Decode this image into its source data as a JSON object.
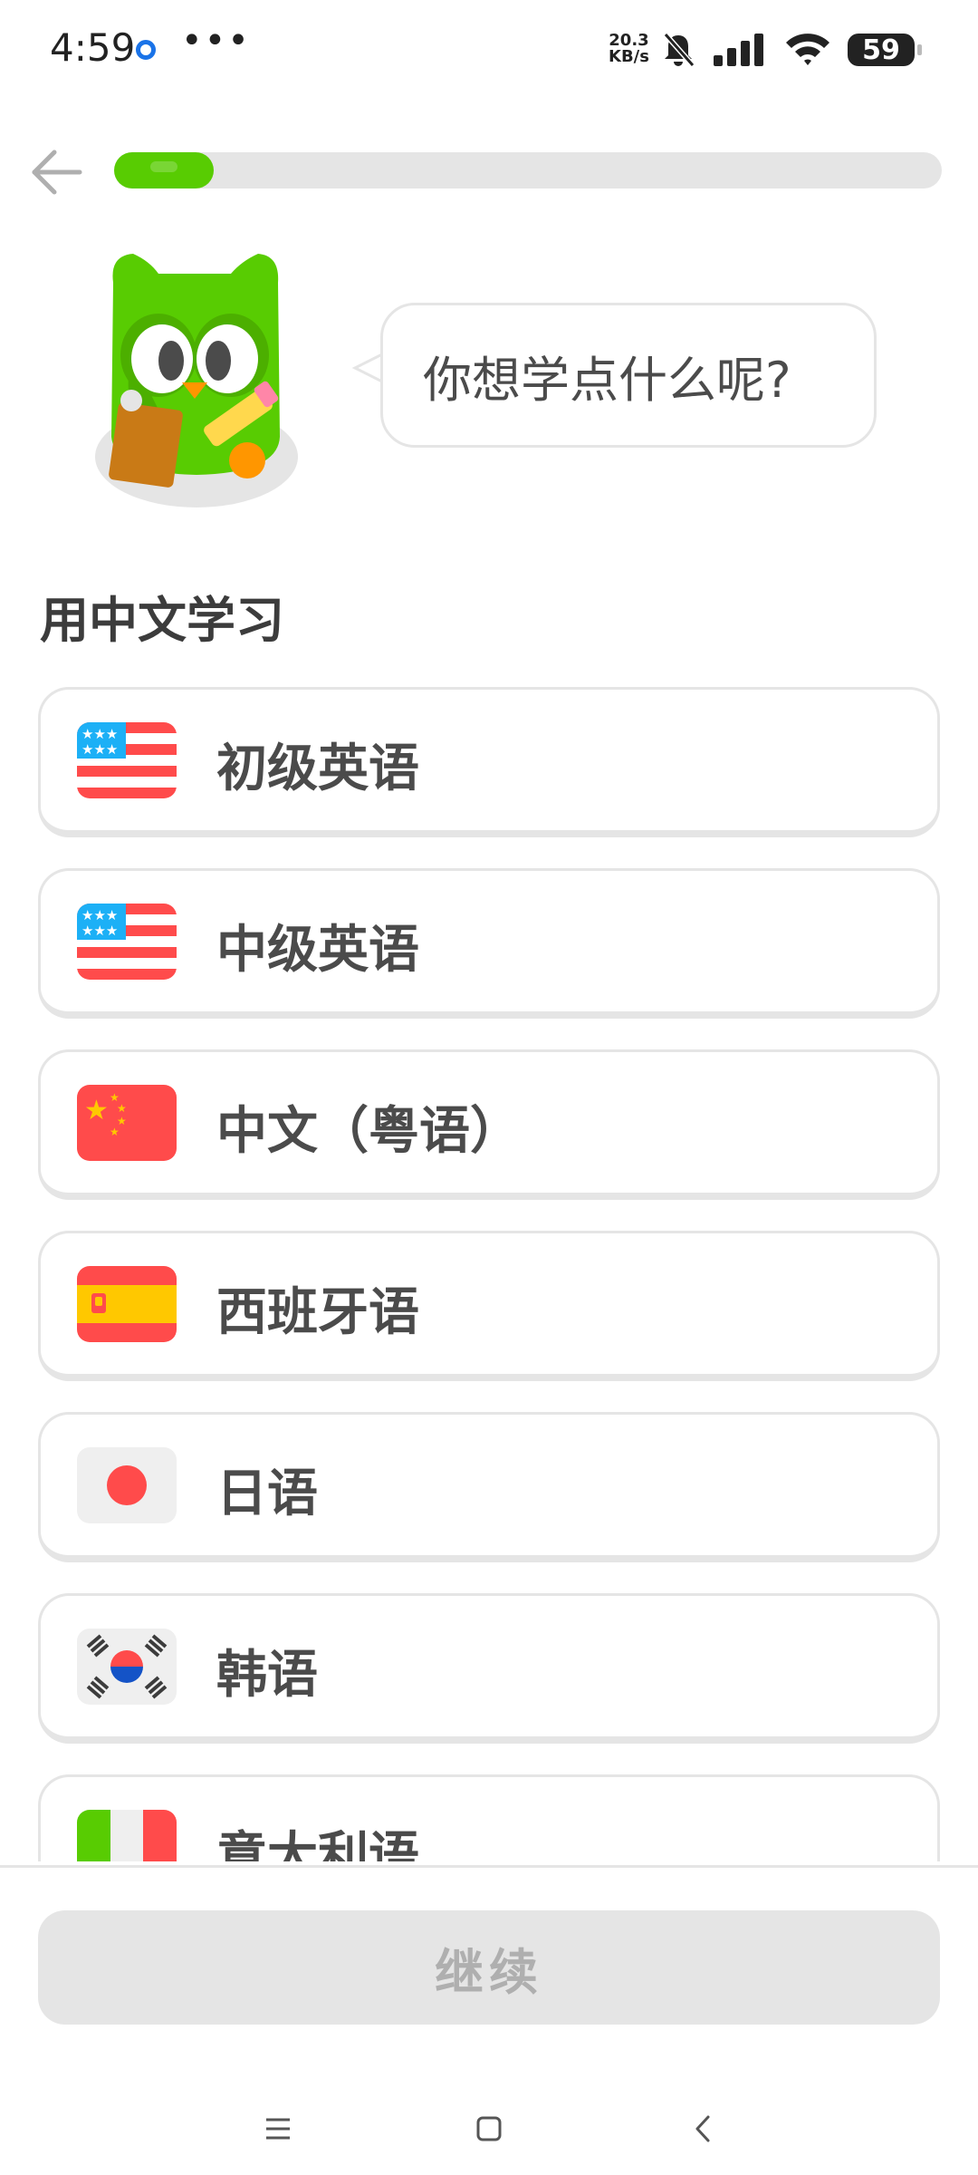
{
  "status_bar": {
    "time": "4:59",
    "net_speed_value": "20.3",
    "net_speed_unit": "KB/s",
    "battery": "59"
  },
  "header": {
    "back_icon": "arrow-left-icon",
    "progress_fraction": 0.12
  },
  "prompt": {
    "question": "你想学点什么呢?"
  },
  "section": {
    "title": "用中文学习"
  },
  "courses": [
    {
      "label": "初级英语",
      "flag": "us-flag-icon"
    },
    {
      "label": "中级英语",
      "flag": "us-flag-icon"
    },
    {
      "label": "中文（粤语）",
      "flag": "china-flag-icon"
    },
    {
      "label": "西班牙语",
      "flag": "spain-flag-icon"
    },
    {
      "label": "日语",
      "flag": "japan-flag-icon"
    },
    {
      "label": "韩语",
      "flag": "korea-flag-icon"
    },
    {
      "label": "意大利语",
      "flag": "italy-flag-icon"
    }
  ],
  "footer": {
    "continue_label": "继续"
  },
  "colors": {
    "brand_green": "#58cc02",
    "border_gray": "#e5e5e5",
    "text_dark": "#4b4b4b",
    "disabled_text": "#afafaf"
  }
}
